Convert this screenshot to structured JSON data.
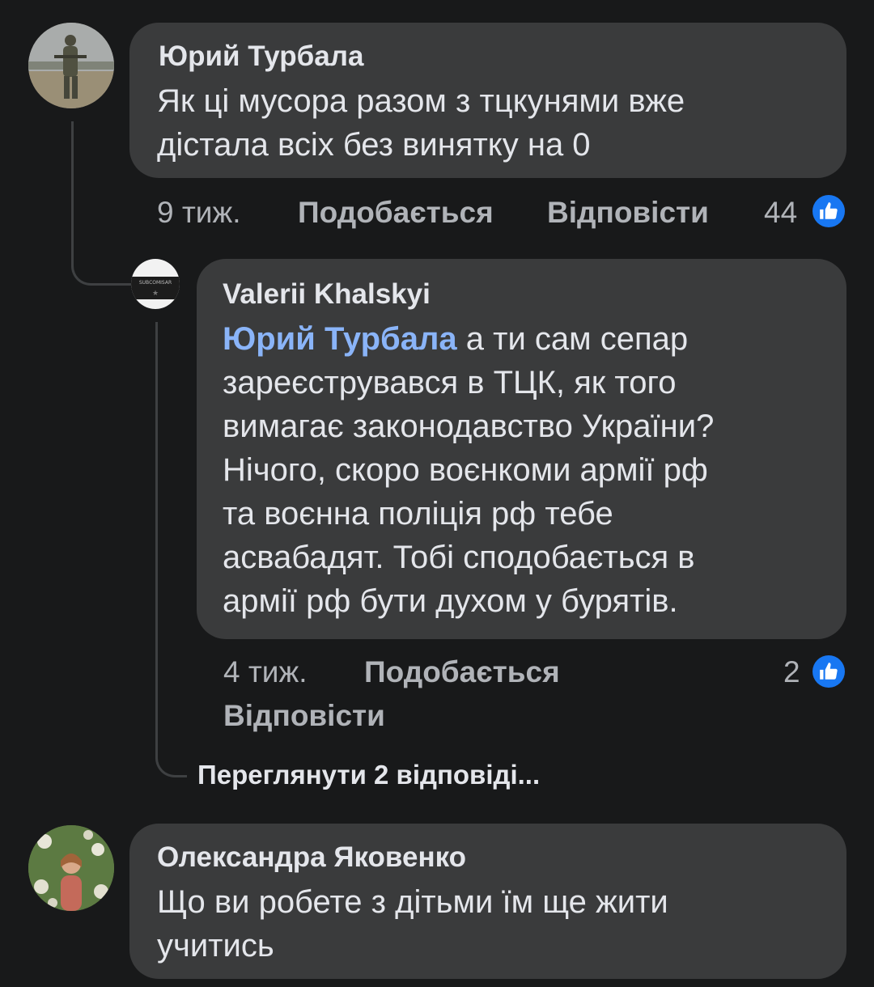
{
  "comments": [
    {
      "author": "Юрий Турбала",
      "lines": [
        "Як ці мусора разом з тцкунями вже",
        "дістала всіх без винятку на 0"
      ],
      "time": "9 тиж.",
      "like_label": "Подобається",
      "reply_label": "Відповісти",
      "reaction_count": "44",
      "reaction_icon": "like-icon"
    },
    {
      "author": "Valerii Khalskyi",
      "avatar_text": "SUBCOMISAR",
      "mention": "Юрий Турбала",
      "first_line_rest": " а ти сам сепар",
      "lines": [
        "зареєструвався в ТЦК,  як того",
        "вимагає законодавство України?",
        "Нічого,  скоро воєнкоми армії рф",
        "та воєнна поліція рф тебе",
        "асвабадят. Тобі сподобається в",
        "армії рф бути духом у бурятів."
      ],
      "time": "4 тиж.",
      "like_label": "Подобається",
      "reply_label": "Відповісти",
      "reaction_count": "2",
      "reaction_icon": "like-icon"
    },
    {
      "author": "Олександра Яковенко",
      "lines": [
        "Що ви робете з дітьми їм ще жити",
        "учитись"
      ]
    }
  ],
  "view_replies": "Переглянути 2 відповіді...",
  "colors": {
    "background": "#18191a",
    "bubble": "#3a3b3c",
    "mention": "#8ab4f8",
    "like": "#1877f2"
  }
}
